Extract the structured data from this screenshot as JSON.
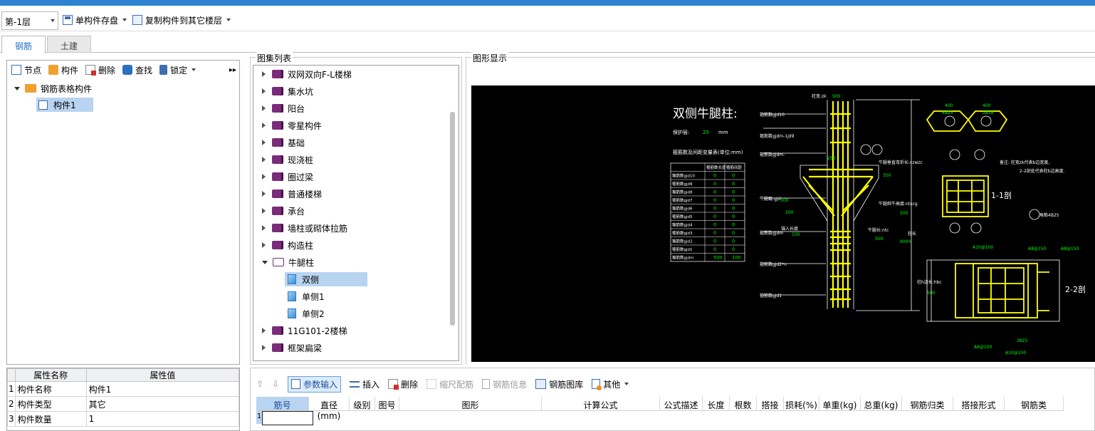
{
  "toolbar": {
    "floor": "第-1层",
    "save_label": "单构件存盘",
    "copy_label": "复制构件到其它楼层"
  },
  "tabs": [
    "钢筋",
    "土建"
  ],
  "left": {
    "tb": [
      "节点",
      "构件",
      "删除",
      "查找",
      "锁定"
    ],
    "tree_root": "钢筋表格构件",
    "tree_child": "构件1"
  },
  "props": {
    "headers": [
      "属性名称",
      "属性值"
    ],
    "rows": [
      {
        "n": "1",
        "name": "构件名称",
        "val": "构件1"
      },
      {
        "n": "2",
        "name": "构件类型",
        "val": "其它"
      },
      {
        "n": "3",
        "name": "构件数量",
        "val": "1"
      }
    ]
  },
  "atlas": {
    "title": "图集列表",
    "items": [
      "双网双向F-L楼梯",
      "集水坑",
      "阳台",
      "零星构件",
      "基础",
      "现浇桩",
      "圈过梁",
      "普通楼梯",
      "承台",
      "墙柱或砌体拉筋",
      "构造柱",
      "牛腿柱"
    ],
    "children": [
      "双侧",
      "单侧1",
      "单侧2"
    ],
    "after": [
      "11G101-2楼梯",
      "框架扁梁"
    ]
  },
  "display": {
    "title": "图形显示",
    "drawing_title": "双侧牛腿柱:",
    "cover_label": "保护层:",
    "cover_val": "25",
    "cover_unit": "mm",
    "table_title": "箍筋数及间距变量表(单位:mm)",
    "table_hdr": [
      "箍筋数长度",
      "箍筋间距"
    ],
    "table_rows": [
      [
        "箍筋数gjd10",
        "0",
        "0"
      ],
      [
        "箍筋数gjd9",
        "0",
        "0"
      ],
      [
        "箍筋数gjd8",
        "0",
        "0"
      ],
      [
        "箍筋数gjd7",
        "0",
        "0"
      ],
      [
        "箍筋数gjd6",
        "0",
        "0"
      ],
      [
        "箍筋数gjd5",
        "0",
        "0"
      ],
      [
        "箍筋数gjd4",
        "0",
        "0"
      ],
      [
        "箍筋数gjd3",
        "0",
        "0"
      ],
      [
        "箍筋数gjd2",
        "0",
        "0"
      ],
      [
        "箍筋数gjd1",
        "0",
        "0"
      ],
      [
        "箍筋数gjdm",
        "500",
        "100"
      ]
    ],
    "labels": {
      "col_width": "柱宽:zk",
      "col_width_val": "500",
      "sec1": "1-1剖",
      "sec2": "2-2剖",
      "note": "备注: 柱宽zk代表b边宽度,",
      "note2": "2-2剖处代表柱b边高度.",
      "corbel_len": "牛腿长:ntc",
      "corbel_len_val": "500",
      "corbel_h": "牛腿斜牛高度:ntxcg",
      "corbel_h_val": "500",
      "col_h": "柱长",
      "col_h_val": "9000",
      "anchor": "锚入长度",
      "anchor_val": "150",
      "v350": "350",
      "v300": "300",
      "v200": "200",
      "v250": "250",
      "v400a": "400",
      "v400b": "400",
      "bar1": "A10@100",
      "bar2": "A8@150",
      "bar3": "A8@150",
      "bar4": "A8@100",
      "bar5": "A10@100",
      "bar6": "3B25",
      "bar7": "4B25",
      "bar8": "3B18",
      "edge": "柱h边长:hbc",
      "edge_val": "500",
      "corner": "角筋4B25",
      "corbel_vert": "牛腿垂直弯折长:czwzc",
      "corbel_wt": "牛腿截:gjd",
      "gjd_a": "箍筋数gjd10",
      "gjd_b": "箍筋数gjdm-1jd9",
      "gjd_c": "箍筋数gjdm-",
      "gjd_d": "箍筋数gjdm",
      "gjd_e": "箍筋数gjd2*n",
      "gjd_f": "箍筋数gjd1"
    }
  },
  "bottom": {
    "param_label": "参数输入",
    "buttons": [
      "插入",
      "删除",
      "缩尺配筋",
      "钢筋信息",
      "钢筋图库",
      "其他"
    ],
    "columns": [
      "筋号",
      "直径(mm)",
      "级别",
      "图号",
      "图形",
      "计算公式",
      "公式描述",
      "长度",
      "根数",
      "搭接",
      "损耗(%)",
      "单重(kg)",
      "总重(kg)",
      "钢筋归类",
      "搭接形式",
      "钢筋类"
    ],
    "row1": "1"
  },
  "colors": {
    "accent": "#2d82d2",
    "selected": "#b8d4f0",
    "drawing_bg": "#000000",
    "drawing_line": "#ffff00",
    "drawing_text": "#ffffff",
    "drawing_num": "#00ff00"
  }
}
